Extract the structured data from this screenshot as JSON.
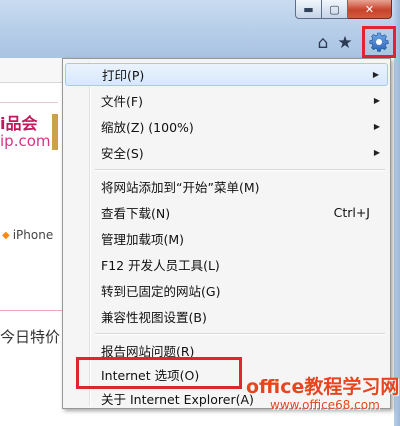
{
  "window": {
    "minimize_glyph": "▬",
    "maximize_glyph": "▢",
    "close_glyph": "✕"
  },
  "toolbar": {
    "home_glyph": "⌂",
    "favorites_glyph": "★",
    "tools_icon": "gear-icon",
    "highlight_color": "#e02431"
  },
  "page": {
    "brand_line1": "i品会",
    "brand_line2": "ip.com",
    "iphone_text": "iPhone",
    "special_text": "今日特价"
  },
  "menu": {
    "items": [
      {
        "label": "打印(P)",
        "shortcut": "",
        "submenu": true
      },
      {
        "label": "文件(F)",
        "shortcut": "",
        "submenu": true
      },
      {
        "label": "缩放(Z) (100%)",
        "shortcut": "",
        "submenu": true
      },
      {
        "label": "安全(S)",
        "shortcut": "",
        "submenu": true
      },
      {
        "label": "将网站添加到“开始”菜单(M)",
        "shortcut": "",
        "submenu": false
      },
      {
        "label": "查看下载(N)",
        "shortcut": "Ctrl+J",
        "submenu": false
      },
      {
        "label": "管理加载项(M)",
        "shortcut": "",
        "submenu": false
      },
      {
        "label": "F12 开发人员工具(L)",
        "shortcut": "",
        "submenu": false
      },
      {
        "label": "转到已固定的网站(G)",
        "shortcut": "",
        "submenu": false
      },
      {
        "label": "兼容性视图设置(B)",
        "shortcut": "",
        "submenu": false
      },
      {
        "label": "报告网站问题(R)",
        "shortcut": "",
        "submenu": false
      },
      {
        "label": "Internet 选项(O)",
        "shortcut": "",
        "submenu": false
      },
      {
        "label": "关于 Internet Explorer(A)",
        "shortcut": "",
        "submenu": false
      }
    ],
    "highlighted_item": "打印(P)",
    "callout_item": "Internet 选项(O)"
  },
  "watermark": {
    "line1": "office教程学习网",
    "line2": "www.office68.com"
  }
}
